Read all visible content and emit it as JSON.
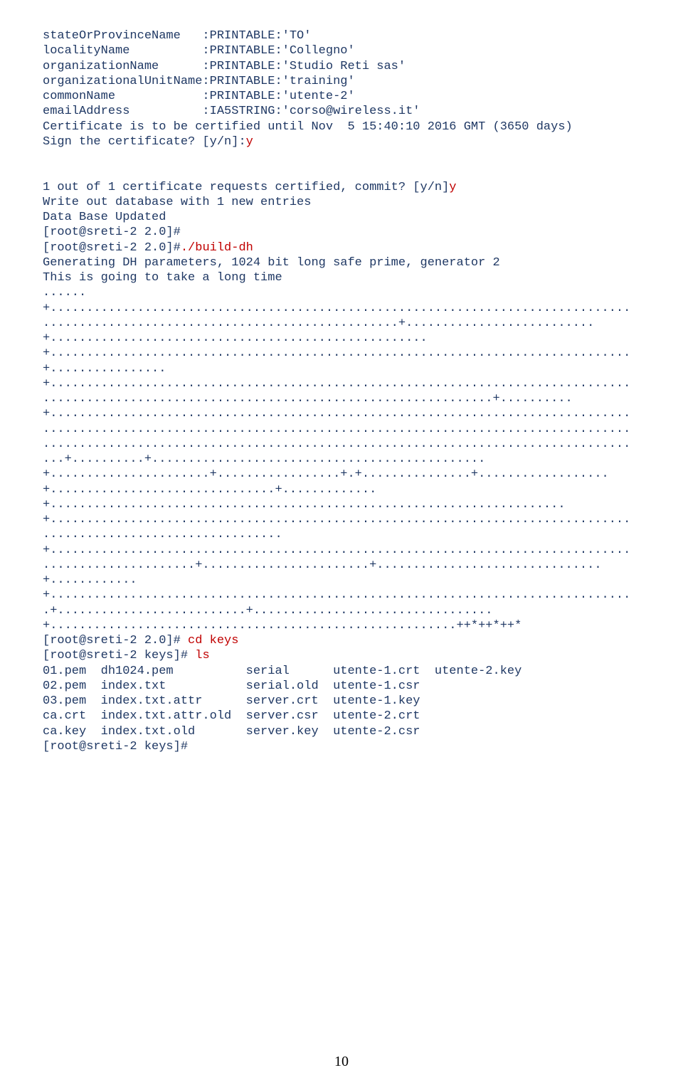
{
  "lines": [
    {
      "parts": [
        {
          "c": "navy",
          "t": "stateOrProvinceName   :PRINTABLE:'TO'"
        }
      ]
    },
    {
      "parts": [
        {
          "c": "navy",
          "t": "localityName          :PRINTABLE:'Collegno'"
        }
      ]
    },
    {
      "parts": [
        {
          "c": "navy",
          "t": "organizationName      :PRINTABLE:'Studio Reti sas'"
        }
      ]
    },
    {
      "parts": [
        {
          "c": "navy",
          "t": "organizationalUnitName:PRINTABLE:'training'"
        }
      ]
    },
    {
      "parts": [
        {
          "c": "navy",
          "t": "commonName            :PRINTABLE:'utente-2'"
        }
      ]
    },
    {
      "parts": [
        {
          "c": "navy",
          "t": "emailAddress          :IA5STRING:'corso@wireless.it'"
        }
      ]
    },
    {
      "parts": [
        {
          "c": "navy",
          "t": "Certificate is to be certified until Nov  5 15:40:10 2016 GMT (3650 days)"
        }
      ]
    },
    {
      "parts": [
        {
          "c": "navy",
          "t": "Sign the certificate? [y/n]:"
        },
        {
          "c": "red",
          "t": "y"
        }
      ]
    },
    {
      "parts": [
        {
          "c": "navy",
          "t": ""
        }
      ]
    },
    {
      "parts": [
        {
          "c": "navy",
          "t": ""
        }
      ]
    },
    {
      "parts": [
        {
          "c": "navy",
          "t": "1 out of 1 certificate requests certified, commit? [y/n]"
        },
        {
          "c": "red",
          "t": "y"
        }
      ]
    },
    {
      "parts": [
        {
          "c": "navy",
          "t": "Write out database with 1 new entries"
        }
      ]
    },
    {
      "parts": [
        {
          "c": "navy",
          "t": "Data Base Updated"
        }
      ]
    },
    {
      "parts": [
        {
          "c": "navy",
          "t": "[root@sreti-2 2.0]#"
        }
      ]
    },
    {
      "parts": [
        {
          "c": "navy",
          "t": "[root@sreti-2 2.0]#"
        },
        {
          "c": "red",
          "t": "./build-dh"
        }
      ]
    },
    {
      "parts": [
        {
          "c": "navy",
          "t": "Generating DH parameters, 1024 bit long safe prime, generator 2"
        }
      ]
    },
    {
      "parts": [
        {
          "c": "navy",
          "t": "This is going to take a long time"
        }
      ]
    },
    {
      "parts": [
        {
          "c": "navy",
          "t": "......"
        }
      ]
    },
    {
      "parts": [
        {
          "c": "navy",
          "t": "+................................................................................"
        }
      ]
    },
    {
      "parts": [
        {
          "c": "navy",
          "t": ".................................................+.........................."
        }
      ]
    },
    {
      "parts": [
        {
          "c": "navy",
          "t": "+...................................................."
        }
      ]
    },
    {
      "parts": [
        {
          "c": "navy",
          "t": "+................................................................................"
        }
      ]
    },
    {
      "parts": [
        {
          "c": "navy",
          "t": "+................"
        }
      ]
    },
    {
      "parts": [
        {
          "c": "navy",
          "t": "+................................................................................"
        }
      ]
    },
    {
      "parts": [
        {
          "c": "navy",
          "t": "..............................................................+.........."
        }
      ]
    },
    {
      "parts": [
        {
          "c": "navy",
          "t": "+................................................................................"
        }
      ]
    },
    {
      "parts": [
        {
          "c": "navy",
          "t": "................................................................................."
        }
      ]
    },
    {
      "parts": [
        {
          "c": "navy",
          "t": "................................................................................."
        }
      ]
    },
    {
      "parts": [
        {
          "c": "navy",
          "t": "...+..........+.............................................."
        }
      ]
    },
    {
      "parts": [
        {
          "c": "navy",
          "t": "+......................+.................+.+...............+.................."
        }
      ]
    },
    {
      "parts": [
        {
          "c": "navy",
          "t": "+...............................+............."
        }
      ]
    },
    {
      "parts": [
        {
          "c": "navy",
          "t": "+......................................................................."
        }
      ]
    },
    {
      "parts": [
        {
          "c": "navy",
          "t": "+................................................................................"
        }
      ]
    },
    {
      "parts": [
        {
          "c": "navy",
          "t": "................................."
        }
      ]
    },
    {
      "parts": [
        {
          "c": "navy",
          "t": "+................................................................................"
        }
      ]
    },
    {
      "parts": [
        {
          "c": "navy",
          "t": ".....................+.......................+..............................."
        }
      ]
    },
    {
      "parts": [
        {
          "c": "navy",
          "t": "+............"
        }
      ]
    },
    {
      "parts": [
        {
          "c": "navy",
          "t": "+................................................................................"
        }
      ]
    },
    {
      "parts": [
        {
          "c": "navy",
          "t": ".+..........................+................................."
        }
      ]
    },
    {
      "parts": [
        {
          "c": "navy",
          "t": "+........................................................++*++*++*"
        }
      ]
    },
    {
      "parts": [
        {
          "c": "navy",
          "t": "[root@sreti-2 2.0]# "
        },
        {
          "c": "red",
          "t": "cd keys"
        }
      ]
    },
    {
      "parts": [
        {
          "c": "navy",
          "t": "[root@sreti-2 keys]# "
        },
        {
          "c": "red",
          "t": "ls"
        }
      ]
    },
    {
      "parts": [
        {
          "c": "navy",
          "t": "01.pem  dh1024.pem          serial      utente-1.crt  utente-2.key"
        }
      ]
    },
    {
      "parts": [
        {
          "c": "navy",
          "t": "02.pem  index.txt           serial.old  utente-1.csr"
        }
      ]
    },
    {
      "parts": [
        {
          "c": "navy",
          "t": "03.pem  index.txt.attr      server.crt  utente-1.key"
        }
      ]
    },
    {
      "parts": [
        {
          "c": "navy",
          "t": "ca.crt  index.txt.attr.old  server.csr  utente-2.crt"
        }
      ]
    },
    {
      "parts": [
        {
          "c": "navy",
          "t": "ca.key  index.txt.old       server.key  utente-2.csr"
        }
      ]
    },
    {
      "parts": [
        {
          "c": "navy",
          "t": "[root@sreti-2 keys]#"
        }
      ]
    }
  ],
  "page_number": "10"
}
